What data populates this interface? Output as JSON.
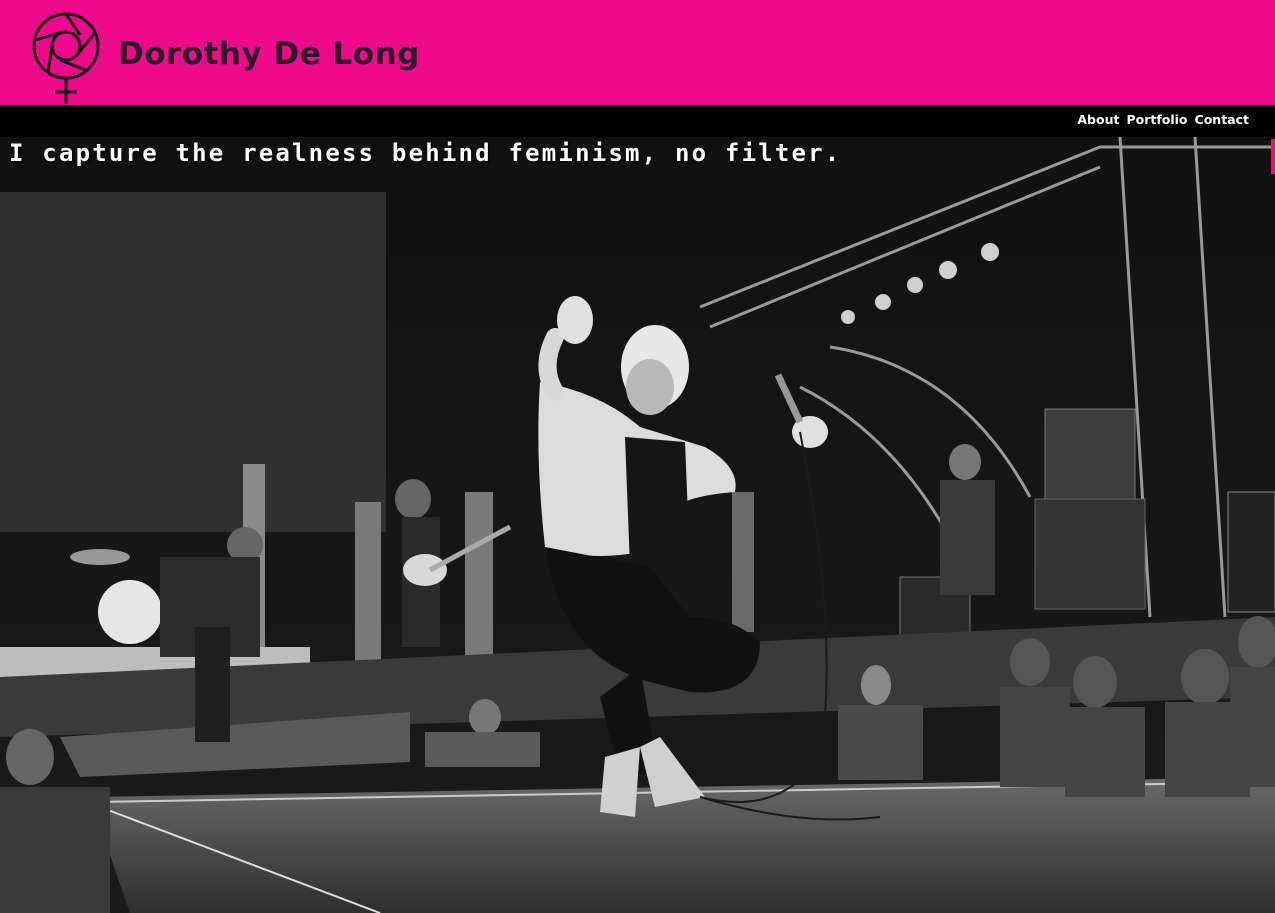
{
  "site": {
    "title": "Dorothy De Long",
    "logo_icon": "camera-aperture-venus-icon"
  },
  "nav": {
    "items": [
      {
        "label": "About"
      },
      {
        "label": "Portfolio"
      },
      {
        "label": "Contact"
      }
    ]
  },
  "hero": {
    "tagline": "I capture the realness behind feminism, no filter.",
    "image": "black-and-white concert photo: barefoot singer jumping on stage with microphone, band and crowd"
  },
  "colors": {
    "brand_pink": "#ee0a8a",
    "nav_bg": "#000000",
    "title_text": "#2a1a2a"
  }
}
